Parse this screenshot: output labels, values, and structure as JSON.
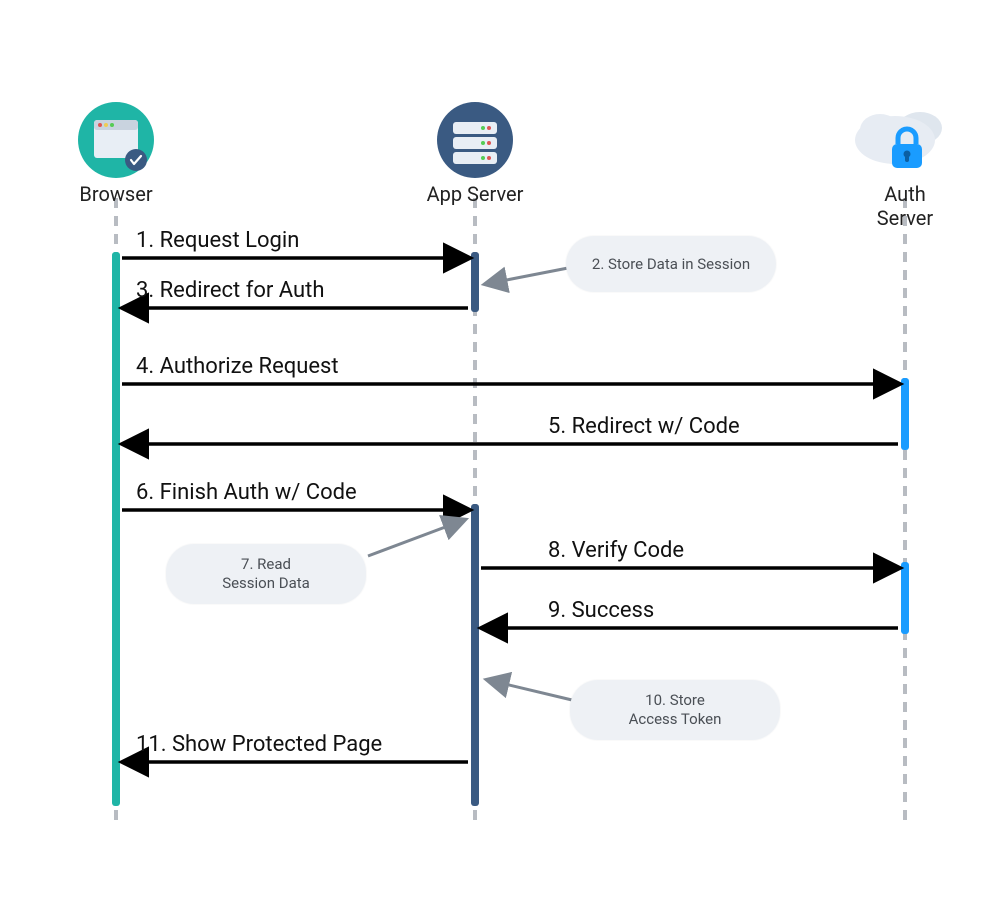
{
  "actors": {
    "browser": {
      "label": "Browser"
    },
    "app_server": {
      "label": "App Server"
    },
    "auth_server": {
      "label": "Auth Server"
    }
  },
  "messages": {
    "m1": "1. Request Login",
    "m3": "3. Redirect for Auth",
    "m4": "4. Authorize Request",
    "m5": "5. Redirect w/ Code",
    "m6": "6. Finish Auth w/ Code",
    "m8": "8. Verify Code",
    "m9": "9. Success",
    "m11": "11. Show Protected Page"
  },
  "notes": {
    "n2": "2. Store Data in Session",
    "n7": "7. Read\nSession Data",
    "n10": "10. Store\nAccess Token"
  },
  "colors": {
    "browser_accent": "#1fb5a6",
    "app_accent": "#3a5a82",
    "auth_accent": "#1a9cff",
    "note_bg": "#eef1f5",
    "arrow": "#000000",
    "note_arrow": "#7e8792",
    "lifeline": "#b8bcc2"
  }
}
